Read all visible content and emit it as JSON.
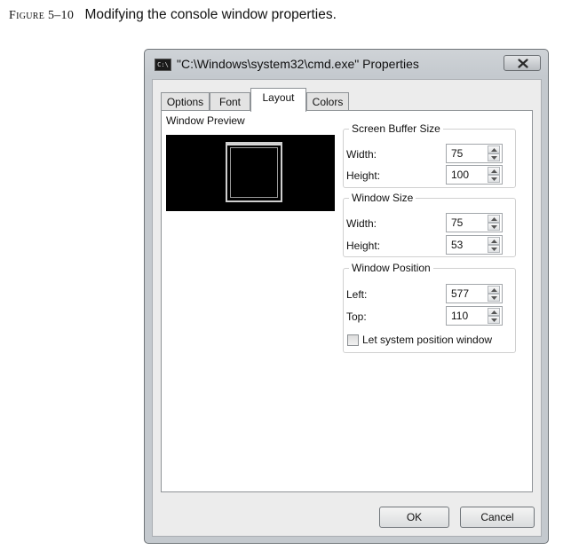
{
  "caption": {
    "figure_label": "Figure 5–10",
    "text": "Modifying the console window properties."
  },
  "window": {
    "title": "\"C:\\Windows\\system32\\cmd.exe\" Properties",
    "icon_text": "C:\\",
    "close_icon": "close-x-icon"
  },
  "tabs": [
    {
      "label": "Options",
      "active": false
    },
    {
      "label": "Font",
      "active": false
    },
    {
      "label": "Layout",
      "active": true
    },
    {
      "label": "Colors",
      "active": false
    }
  ],
  "layout": {
    "preview_label": "Window Preview",
    "screen_buffer": {
      "legend": "Screen Buffer Size",
      "width_label": "Width:",
      "width_value": "75",
      "height_label": "Height:",
      "height_value": "100"
    },
    "window_size": {
      "legend": "Window Size",
      "width_label": "Width:",
      "width_value": "75",
      "height_label": "Height:",
      "height_value": "53"
    },
    "window_position": {
      "legend": "Window Position",
      "left_label": "Left:",
      "left_value": "577",
      "top_label": "Top:",
      "top_value": "110",
      "let_system_label": "Let system position window",
      "let_system_checked": false
    }
  },
  "buttons": {
    "ok": "OK",
    "cancel": "Cancel"
  },
  "colors": {
    "title_bar": "#c4c9ce",
    "preview_bg": "#000000",
    "panel_bg": "#ffffff"
  }
}
